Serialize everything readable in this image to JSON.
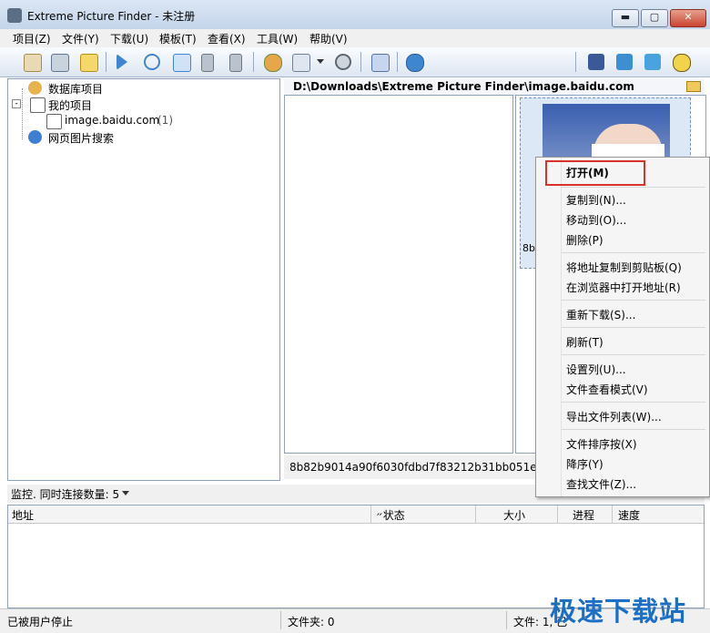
{
  "window": {
    "title": "Extreme Picture Finder - 未注册",
    "controls": {
      "minimize": "▬",
      "maximize": "▢",
      "close": "✕"
    }
  },
  "menubar": [
    "项目(Z)",
    "文件(Y)",
    "下载(U)",
    "模板(T)",
    "查看(X)",
    "工具(W)",
    "帮助(V)"
  ],
  "toolbar": {
    "icons": [
      "new-project-icon",
      "edit-project-icon",
      "note-icon",
      "play-icon",
      "refresh-icon",
      "step-icon",
      "stop-icon",
      "queue-icon",
      "globe-icon",
      "view-mode-icon",
      "settings-icon",
      "image-tool-icon",
      "help-icon"
    ],
    "social": [
      "facebook-icon",
      "google-icon",
      "twitter-icon",
      "community-icon"
    ]
  },
  "tree": {
    "items": [
      {
        "label": "数据库项目",
        "count": ""
      },
      {
        "label": "我的项目",
        "count": ""
      },
      {
        "label": "image.baidu.com",
        "count": "(1)"
      },
      {
        "label": "网页图片搜索",
        "count": ""
      }
    ]
  },
  "path": "D:\\Downloads\\Extreme Picture Finder\\image.baidu.com",
  "thumbnail": {
    "caption": "8b8"
  },
  "filename": "8b82b9014a90f6030fdbd7f83212b31bb051ed22.jpg",
  "monitor": {
    "label": "监控. 同时连接数量: 5"
  },
  "download_table": {
    "columns": [
      "地址",
      "״状态",
      "大小",
      "进程",
      "速度"
    ]
  },
  "status": {
    "left": "已被用户停止",
    "folders": "文件夹: 0",
    "files": "文件: 1, 已"
  },
  "watermark": "极速下载站",
  "context_menu": {
    "items": [
      "打开(M)",
      "复制到(N)...",
      "移动到(O)...",
      "删除(P)",
      "将地址复制到剪贴板(Q)",
      "在浏览器中打开地址(R)",
      "重新下载(S)...",
      "刷新(T)",
      "设置列(U)...",
      "文件查看模式(V)",
      "导出文件列表(W)...",
      "文件排序按(X)",
      "降序(Y)",
      "查找文件(Z)..."
    ]
  },
  "colors": {
    "highlight": "#d9322c",
    "accent": "#1b6fc4"
  }
}
